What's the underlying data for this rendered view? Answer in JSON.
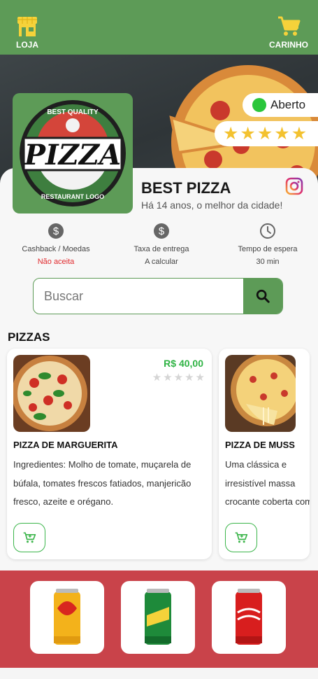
{
  "topbar": {
    "store_label": "LOJA",
    "cart_label": "CARINHO",
    "background": "#5d9b57"
  },
  "store": {
    "name": "BEST PIZZA",
    "tagline": "Há 14 anos, o melhor da cidade!",
    "status": "Aberto",
    "status_color": "#2ac63b",
    "rating": 5,
    "logo_text": "PIZZA",
    "logo_top": "BEST QUALITY",
    "logo_bottom": "RESTAURANT LOGO"
  },
  "info": [
    {
      "icon": "dollar-icon",
      "label": "Cashback / Moedas",
      "value": "Não aceita",
      "value_color": "#e0292c"
    },
    {
      "icon": "dollar-icon",
      "label": "Taxa de entrega",
      "value": "A calcular"
    },
    {
      "icon": "clock-icon",
      "label": "Tempo de espera",
      "value": "30 min"
    }
  ],
  "search": {
    "placeholder": "Buscar"
  },
  "section": {
    "title": "PIZZAS"
  },
  "products": [
    {
      "name": "PIZZA DE MARGUERITA",
      "price": "R$ 40,00",
      "rating": 0,
      "description": "Ingredientes: Molho de tomate, muçarela de búfala, tomates frescos fatiados, manjericão fresco, azeite e orégano."
    },
    {
      "name": "PIZZA DE MUSS",
      "price": "",
      "rating": 0,
      "description": "Uma clássica e irresistível massa crocante coberta com um"
    }
  ],
  "drinks": [
    {
      "icon": "guarana-can-icon"
    },
    {
      "icon": "kuat-can-icon"
    },
    {
      "icon": "coca-cola-can-icon"
    }
  ],
  "colors": {
    "brand_green": "#5d9b57",
    "price_green": "#2fb344",
    "drinks_bg": "#c9434a"
  }
}
